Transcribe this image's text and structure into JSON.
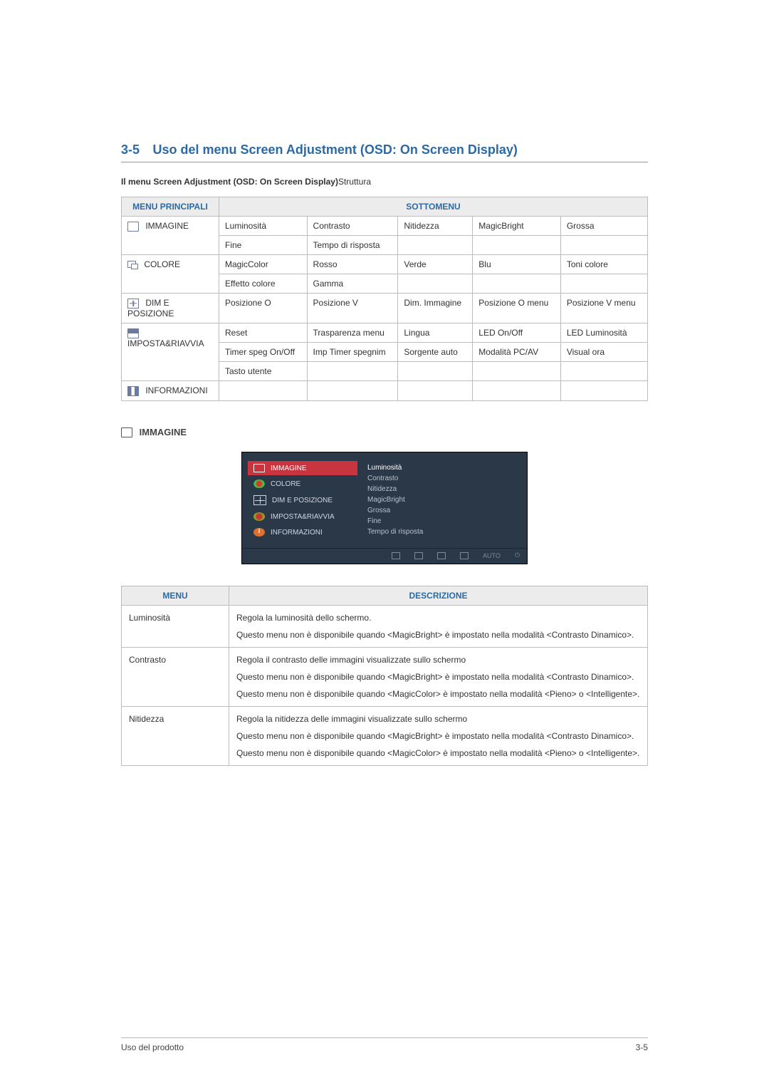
{
  "heading": {
    "num": "3-5",
    "title": "Uso del menu Screen Adjustment (OSD: On Screen Display)"
  },
  "subtitle": {
    "bold": "Il menu Screen Adjustment (OSD: On Screen Display)",
    "rest": "Struttura"
  },
  "table": {
    "h1": "MENU PRINCIPALI",
    "h2": "SOTTOMENU",
    "rows": [
      {
        "menu": "IMMAGINE",
        "icon": "rect",
        "cells": [
          [
            "Luminosità",
            "Contrasto",
            "Nitidezza",
            "MagicBright",
            "Grossa"
          ],
          [
            "Fine",
            "Tempo di risposta",
            "",
            "",
            ""
          ]
        ]
      },
      {
        "menu": "COLORE",
        "icon": "color",
        "cells": [
          [
            "MagicColor",
            "Rosso",
            "Verde",
            "Blu",
            "Toni colore"
          ],
          [
            "Effetto colore",
            "Gamma",
            "",
            "",
            ""
          ]
        ]
      },
      {
        "menu": "DIM E POSIZIONE",
        "icon": "pos",
        "cells": [
          [
            "Posizione O",
            "Posizione V",
            "Dim. Immagine",
            "Posizione O menu",
            "Posizione V menu"
          ]
        ]
      },
      {
        "menu": "IMPOSTA&RIAVVIA",
        "icon": "set",
        "cells": [
          [
            "Reset",
            "Trasparenza menu",
            "Lingua",
            "LED On/Off",
            "LED Luminosità"
          ],
          [
            "Timer speg On/Off",
            "Imp Timer spegnim",
            "Sorgente auto",
            "Modalità PC/AV",
            "Visual ora"
          ],
          [
            "Tasto utente",
            "",
            "",
            "",
            ""
          ]
        ]
      },
      {
        "menu": "INFORMAZIONI",
        "icon": "info",
        "cells": [
          [
            "",
            "",
            "",
            "",
            ""
          ]
        ]
      }
    ]
  },
  "section_title": "IMMAGINE",
  "osd": {
    "menu": [
      "IMMAGINE",
      "COLORE",
      "DIM E POSIZIONE",
      "IMPOSTA&RIAVVIA",
      "INFORMAZIONI"
    ],
    "sub": [
      "Luminosità",
      "Contrasto",
      "Nitidezza",
      "MagicBright",
      "Grossa",
      "Fine",
      "Tempo di risposta"
    ],
    "bar": {
      "auto": "AUTO"
    }
  },
  "desc": {
    "h1": "MENU",
    "h2": "DESCRIZIONE",
    "rows": [
      {
        "m": "Luminosità",
        "d": [
          "Regola la luminosità dello schermo.",
          "Questo menu non è disponibile quando <MagicBright> è impostato nella modalità <Contrasto Dinamico>."
        ]
      },
      {
        "m": "Contrasto",
        "d": [
          "Regola il contrasto delle immagini visualizzate sullo schermo",
          "Questo menu non è disponibile quando <MagicBright> è impostato nella modalità <Contrasto Dinamico>.",
          "Questo menu non è disponibile quando <MagicColor> è impostato nella modalità <Pieno> o <Intelligente>."
        ]
      },
      {
        "m": "Nitidezza",
        "d": [
          "Regola la nitidezza delle immagini visualizzate sullo schermo",
          "Questo menu non è disponibile quando <MagicBright> è impostato nella modalità <Contrasto Dinamico>.",
          "Questo menu non è disponibile quando <MagicColor> è impostato nella modalità <Pieno> o <Intelligente>."
        ]
      }
    ]
  },
  "footer": {
    "left": "Uso del prodotto",
    "right": "3-5"
  }
}
